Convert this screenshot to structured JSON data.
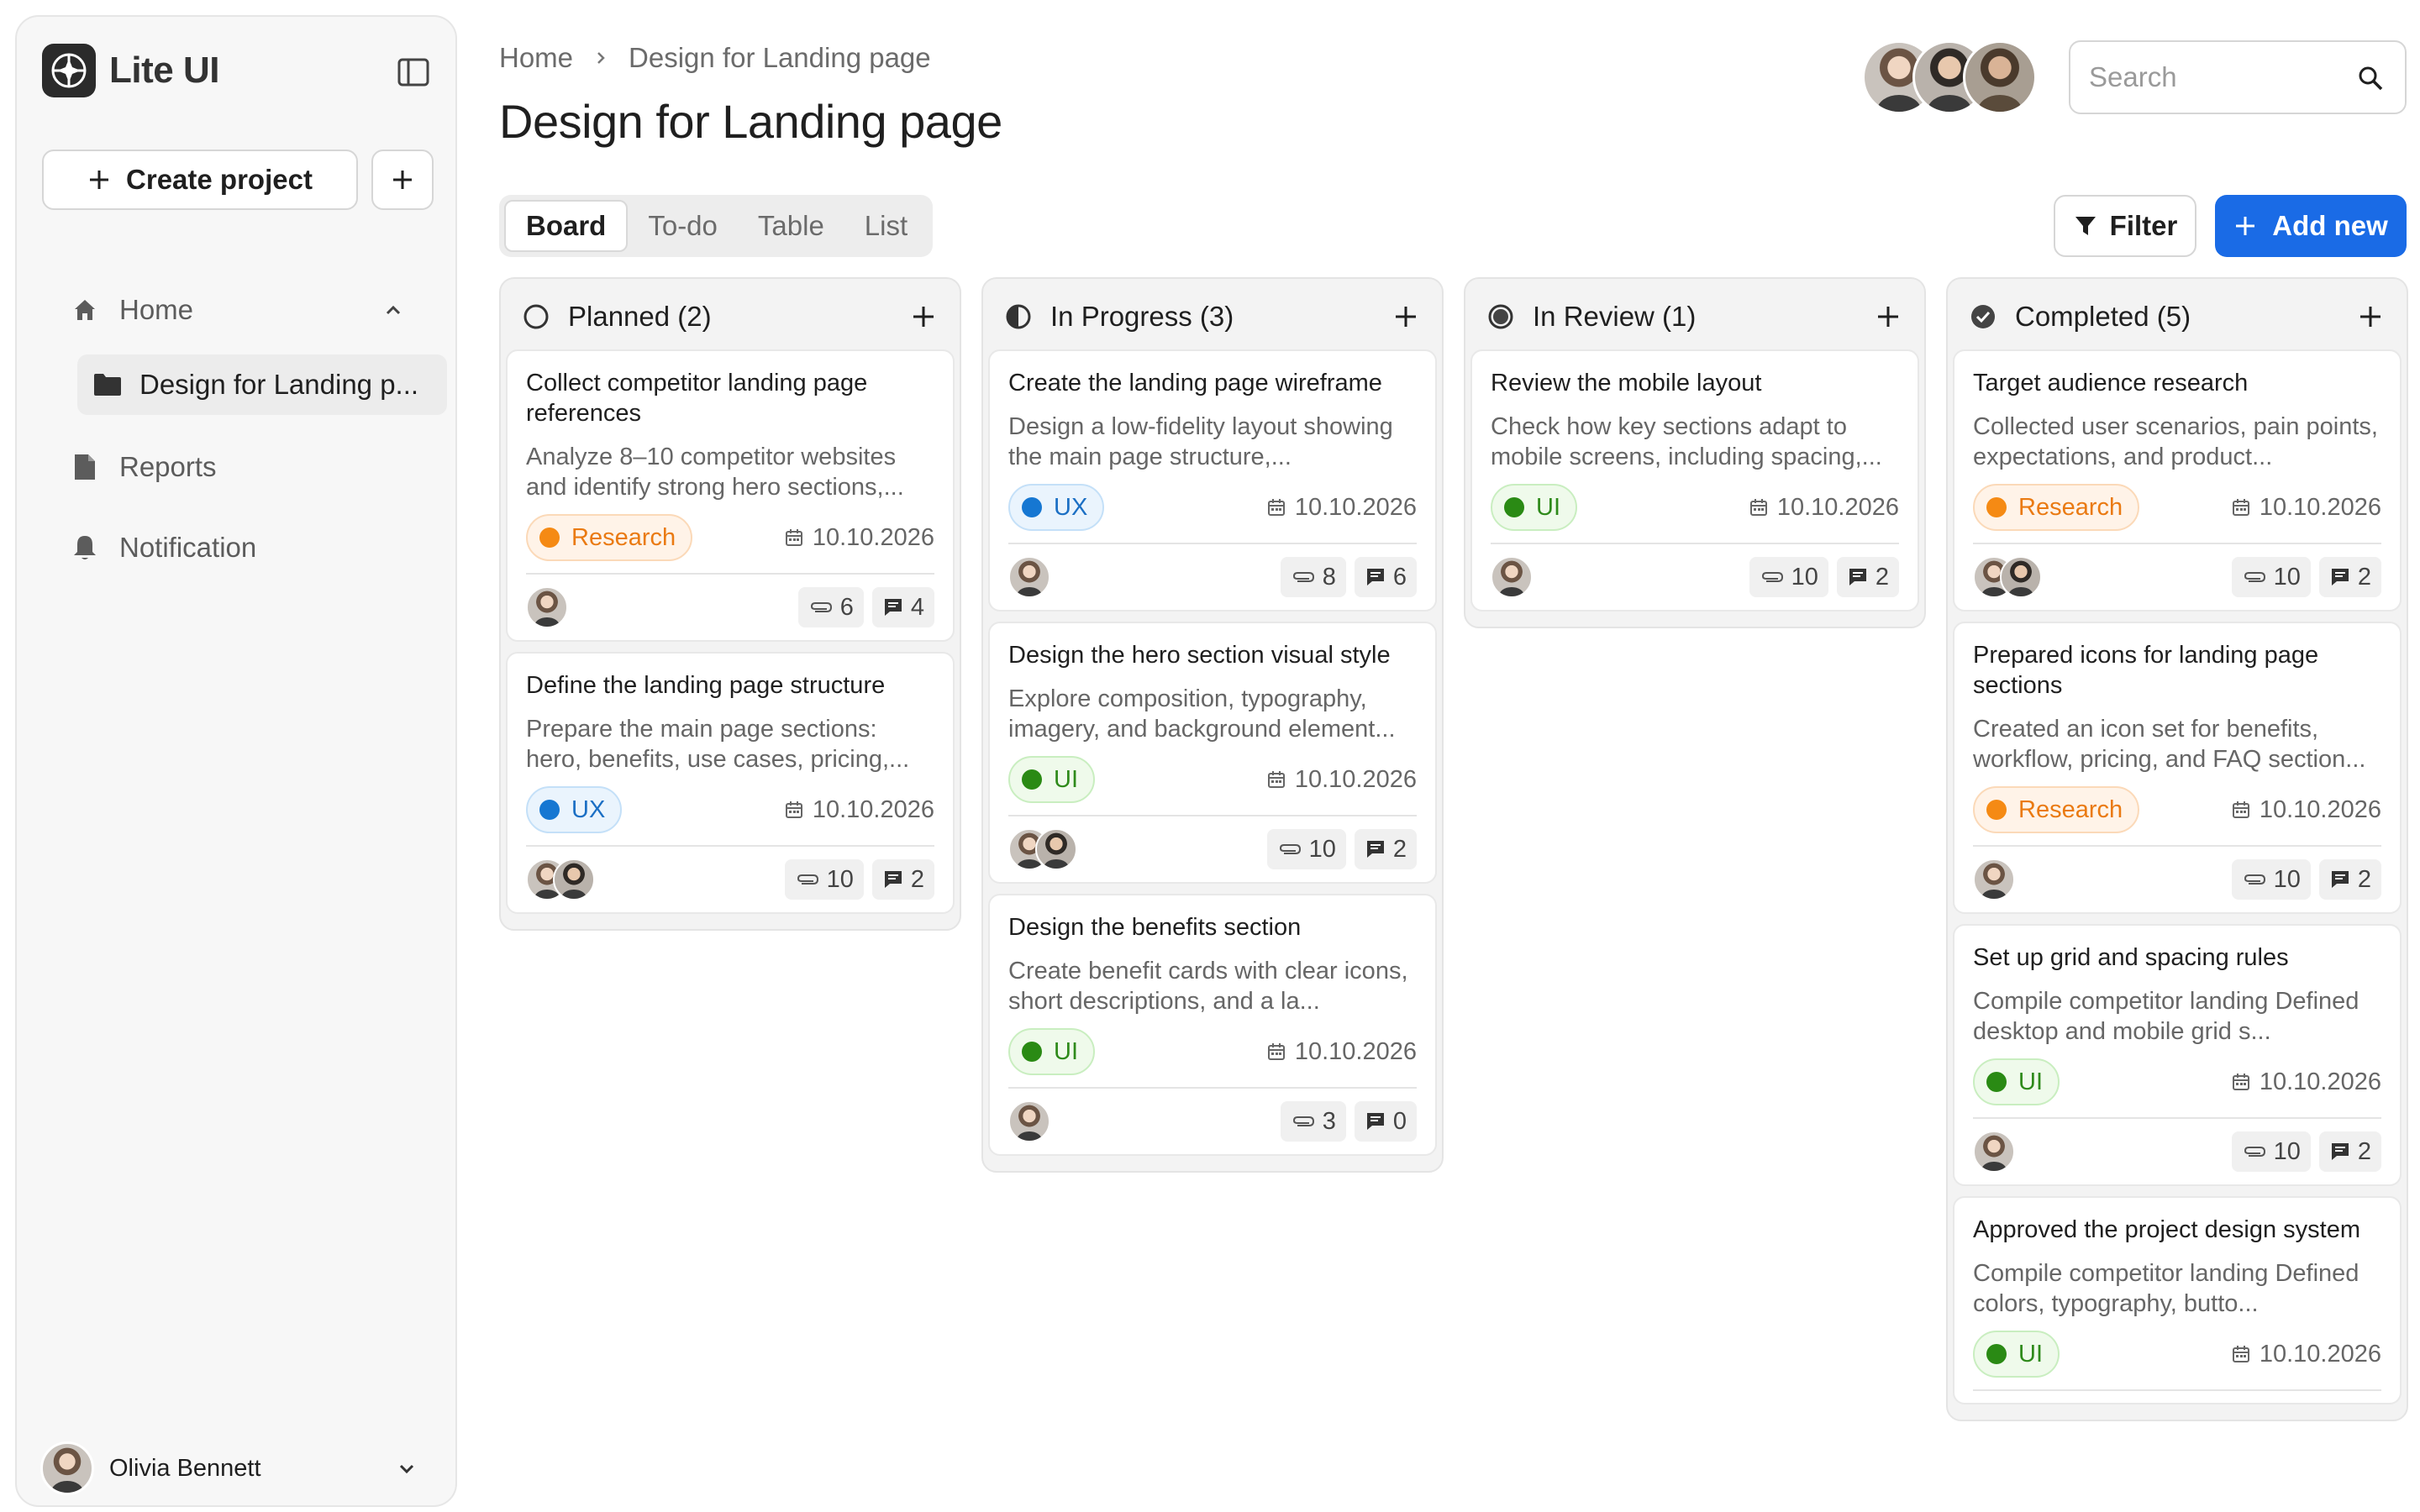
{
  "app": {
    "name": "Lite UI"
  },
  "sidebar": {
    "create_label": "Create project",
    "nav": {
      "home": "Home",
      "current_project": "Design for Landing p...",
      "reports": "Reports",
      "notification": "Notification"
    },
    "user": {
      "name": "Olivia Bennett"
    }
  },
  "header": {
    "breadcrumb": {
      "home": "Home",
      "current": "Design for Landing page"
    },
    "title": "Design for Landing page",
    "search_placeholder": "Search"
  },
  "tabs": [
    "Board",
    "To-do",
    "Table",
    "List"
  ],
  "actions": {
    "filter": "Filter",
    "add_new": "Add new"
  },
  "colors": {
    "accent": "#1a6be6",
    "research": "#f58a14",
    "ux": "#1677d2",
    "ui": "#2a8a14"
  },
  "board": {
    "columns": [
      {
        "title": "Planned (2)",
        "status_icon": "circle-empty-icon",
        "cards": [
          {
            "title": "Collect competitor landing page references",
            "desc": "Analyze 8–10 competitor websites and identify strong hero sections,...",
            "tag": "Research",
            "tag_type": "research",
            "date": "10.10.2026",
            "attachments": "6",
            "comments": "4",
            "avatars": 1
          },
          {
            "title": "Define the landing page structure",
            "desc": "Prepare the main page sections: hero, benefits, use cases, pricing,...",
            "tag": "UX",
            "tag_type": "ux",
            "date": "10.10.2026",
            "attachments": "10",
            "comments": "2",
            "avatars": 2
          }
        ]
      },
      {
        "title": "In Progress (3)",
        "status_icon": "circle-half-icon",
        "cards": [
          {
            "title": "Create the landing page wireframe",
            "desc": "Design a low-fidelity layout showing the main page structure,...",
            "tag": "UX",
            "tag_type": "ux",
            "date": "10.10.2026",
            "attachments": "8",
            "comments": "6",
            "avatars": 1
          },
          {
            "title": "Design the hero section visual style",
            "desc": "Explore composition, typography, imagery, and background element...",
            "tag": "UI",
            "tag_type": "ui",
            "date": "10.10.2026",
            "attachments": "10",
            "comments": "2",
            "avatars": 2
          },
          {
            "title": "Design the benefits section",
            "desc": "Create benefit cards with clear icons, short descriptions, and a la...",
            "tag": "UI",
            "tag_type": "ui",
            "date": "10.10.2026",
            "attachments": "3",
            "comments": "0",
            "avatars": 1
          }
        ]
      },
      {
        "title": "In Review (1)",
        "status_icon": "circle-filled-icon",
        "cards": [
          {
            "title": "Review the mobile layout",
            "desc": "Check how key sections adapt to mobile screens, including spacing,...",
            "tag": "UI",
            "tag_type": "ui",
            "date": "10.10.2026",
            "attachments": "10",
            "comments": "2",
            "avatars": 1
          }
        ]
      },
      {
        "title": "Completed (5)",
        "status_icon": "circle-check-icon",
        "cards": [
          {
            "title": "Target audience research",
            "desc": "Collected user scenarios, pain points, expectations, and product...",
            "tag": "Research",
            "tag_type": "research",
            "date": "10.10.2026",
            "attachments": "10",
            "comments": "2",
            "avatars": 2
          },
          {
            "title": "Prepared icons for landing page sections",
            "desc": "Created an icon set for benefits, workflow, pricing, and FAQ section...",
            "tag": "Research",
            "tag_type": "research",
            "date": "10.10.2026",
            "attachments": "10",
            "comments": "2",
            "avatars": 1
          },
          {
            "title": "Set up grid and spacing rules",
            "desc": "Compile competitor landing Defined desktop and mobile grid s...",
            "tag": "UI",
            "tag_type": "ui",
            "date": "10.10.2026",
            "attachments": "10",
            "comments": "2",
            "avatars": 1
          },
          {
            "title": "Approved the project design system",
            "desc": "Compile competitor landing Defined colors, typography, butto...",
            "tag": "UI",
            "tag_type": "ui",
            "date": "10.10.2026",
            "attachments": "",
            "comments": "",
            "avatars": 0
          }
        ]
      }
    ]
  }
}
